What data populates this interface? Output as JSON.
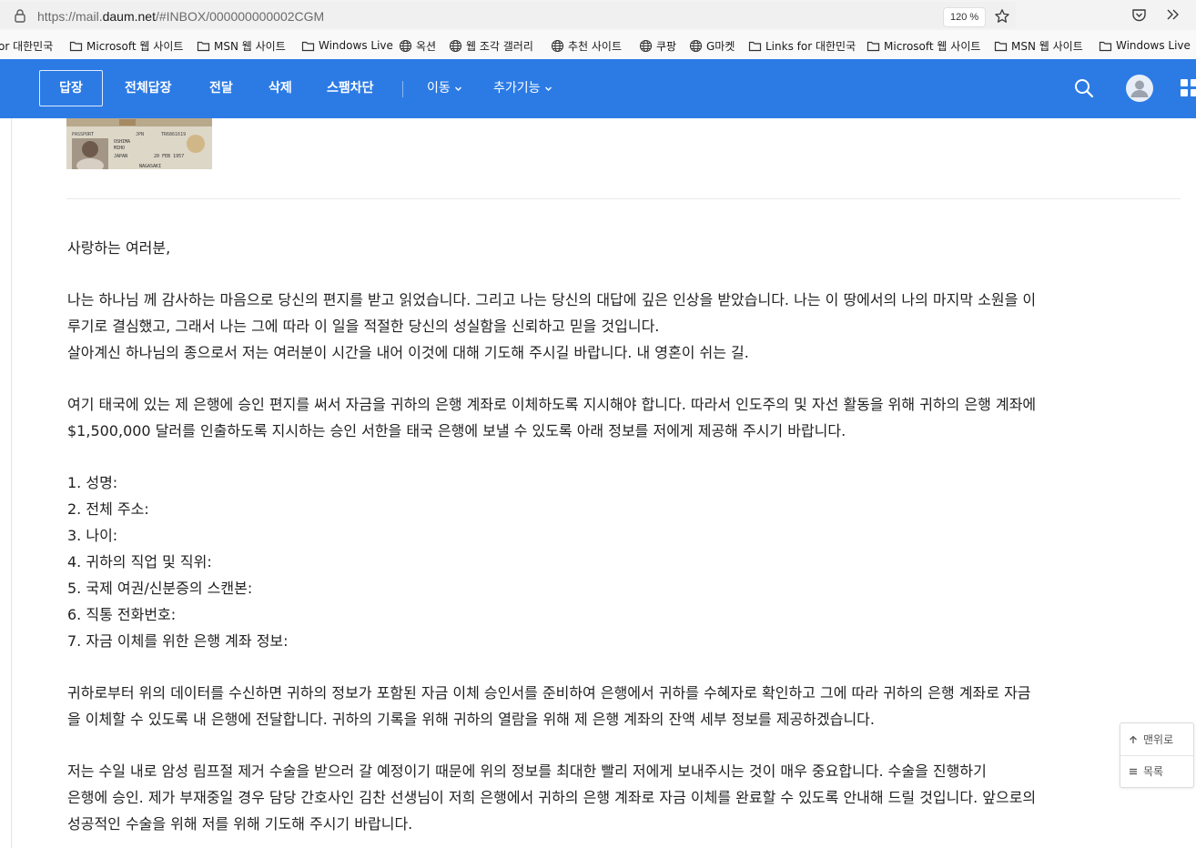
{
  "browser": {
    "url_prefix": "https://mail.",
    "url_domain": "daum.net",
    "url_path": "/#INBOX/000000000002CGM",
    "zoom": "120 %"
  },
  "bookmarks": [
    {
      "label": "or 대한민국",
      "icon": "none"
    },
    {
      "label": "Microsoft 웹 사이트",
      "icon": "folder-icon"
    },
    {
      "label": "MSN 웹 사이트",
      "icon": "folder-icon"
    },
    {
      "label": "Windows Live",
      "icon": "folder-icon"
    },
    {
      "label": "옥션",
      "icon": "globe-icon"
    },
    {
      "label": "웹 조각 갤러리",
      "icon": "globe-icon"
    },
    {
      "label": "추천 사이트",
      "icon": "globe-icon"
    },
    {
      "label": "쿠팡",
      "icon": "globe-icon"
    },
    {
      "label": "G마켓",
      "icon": "globe-icon"
    },
    {
      "label": "Links for 대한민국",
      "icon": "folder-icon"
    },
    {
      "label": "Microsoft 웹 사이트",
      "icon": "folder-icon"
    },
    {
      "label": "MSN 웹 사이트",
      "icon": "folder-icon"
    },
    {
      "label": "Windows Live",
      "icon": "folder-icon"
    }
  ],
  "toolbar": {
    "reply": "답장",
    "reply_all": "전체답장",
    "forward": "전달",
    "delete": "삭제",
    "block_spam": "스팸차단",
    "move": "이동",
    "more": "추가기능",
    "accent_color": "#2c7be5"
  },
  "attachment": {
    "passport_header": "PASSPORT",
    "country_code": "JPN",
    "surname": "OSHIMA",
    "given_name": "MIHO",
    "nationality": "JAPAN",
    "dob": "20 FEB 1957",
    "place": "NAGASAKI",
    "passport_no": "TR6861619"
  },
  "mail": {
    "greeting": "사랑하는 여러분,",
    "p1_line1": "나는 하나님 께 감사하는 마음으로 당신의 편지를 받고 읽었습니다. 그리고 나는 당신의 대답에 깊은 인상을 받았습니다. 나는 이 땅에서의 나의 마지막 소원을 이",
    "p1_line2": "루기로 결심했고, 그래서 나는 그에 따라 이 일을 적절한 당신의 성실함을 신뢰하고 믿을 것입니다.",
    "p1_line3": "살아계신 하나님의 종으로서 저는 여러분이 시간을 내어 이것에 대해 기도해 주시길 바랍니다. 내 영혼이 쉬는 길.",
    "p2_line1": "여기 태국에 있는 제 은행에 승인 편지를 써서 자금을 귀하의 은행 계좌로 이체하도록 지시해야 합니다. 따라서 인도주의 및 자선 활동을 위해 귀하의 은행 계좌에",
    "p2_line2": "$1,500,000 달러를 인출하도록 지시하는 승인 서한을 태국 은행에 보낼 수 있도록 아래 정보를 저에게 제공해 주시기 바랍니다.",
    "list": [
      "1. 성명:",
      "2. 전체 주소:",
      "3. 나이:",
      "4. 귀하의 직업 및 직위:",
      "5. 국제 여권/신분증의 스캔본:",
      "6. 직통 전화번호:",
      "7. 자금 이체를 위한 은행 계좌 정보:"
    ],
    "p3_line1": "귀하로부터 위의 데이터를 수신하면 귀하의 정보가 포함된 자금 이체 승인서를 준비하여 은행에서 귀하를 수혜자로 확인하고 그에 따라 귀하의 은행 계좌로 자금",
    "p3_line2": "을 이체할 수 있도록 내 은행에 전달합니다. 귀하의 기록을 위해 귀하의 열람을 위해 제 은행 계좌의 잔액 세부 정보를 제공하겠습니다.",
    "p4_line1": "저는 수일 내로 암성 림프절 제거 수술을 받으러 갈 예정이기 때문에 위의 정보를 최대한 빨리 저에게 보내주시는 것이 매우 중요합니다. 수술을 진행하기",
    "p4_line2": "은행에 승인. 제가 부재중일 경우 담당 간호사인 김찬 선생님이 저희 은행에서 귀하의 은행 계좌로 자금 이체를 완료할 수 있도록 안내해 드릴 것입니다. 앞으로의",
    "p4_line3": "성공적인 수술을 위해 저를 위해 기도해 주시기 바랍니다."
  },
  "float_nav": {
    "top": "맨위로",
    "list": "목록"
  }
}
